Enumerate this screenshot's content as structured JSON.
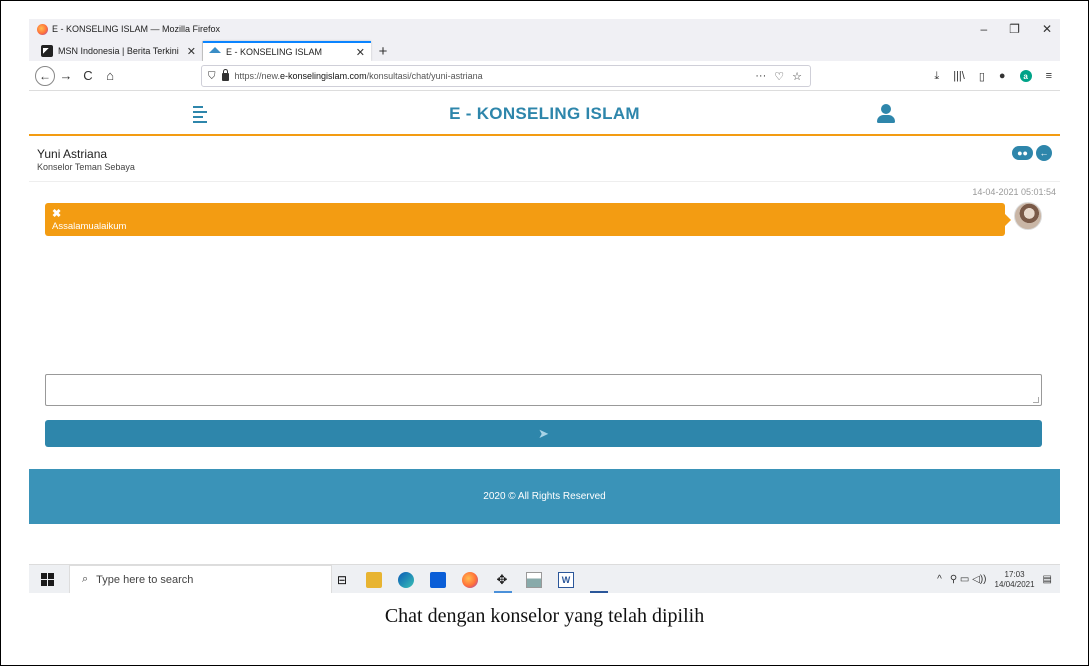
{
  "window": {
    "title": "E - KONSELING ISLAM — Mozilla Firefox",
    "controls": {
      "minimize": "–",
      "restore": "❐",
      "close": "✕"
    }
  },
  "tabs": [
    {
      "label": "MSN Indonesia | Berita Terkini |",
      "close": "✕"
    },
    {
      "label": "E - KONSELING ISLAM",
      "close": "✕"
    }
  ],
  "new_tab": "+",
  "nav": {
    "back": "←",
    "forward": "→",
    "reload": "C",
    "home": "⌂"
  },
  "url": {
    "prefix": "https://new.",
    "domain": "e-konselingislam.com",
    "path": "/konsultasi/chat/yuni-astriana",
    "more": "···",
    "pocket": "♡",
    "bookmark": "☆"
  },
  "toolbar_icons": {
    "download": "⤓",
    "library": "|||\\",
    "sidebar": "▯",
    "extension": "●",
    "account": "a",
    "menu": "≡"
  },
  "app": {
    "title": "E - KONSELING ISLAM",
    "accent": "#f39c12",
    "primary": "#2e86ab"
  },
  "chat": {
    "counselor_name": "Yuni Astriana",
    "counselor_role": "Konselor Teman Sebaya",
    "btn_chat_icon": "●●",
    "btn_back_icon": "←",
    "messages": [
      {
        "time": "14-04-2021 05:01:54",
        "delete": "✖",
        "text": "Assalamualaikum"
      }
    ],
    "send_icon": "➤"
  },
  "footer": {
    "text": "2020 © All Rights Reserved"
  },
  "taskbar": {
    "search_placeholder": "Type here to search",
    "search_icon": "⌕",
    "task_view": "⊟",
    "word": "W",
    "tray_chevron": "^",
    "tray_icons": "⚲ ▭ ◁))",
    "time": "17:03",
    "date": "14/04/2021",
    "notifications": "▤"
  },
  "caption": "Chat dengan konselor yang telah dipilih"
}
